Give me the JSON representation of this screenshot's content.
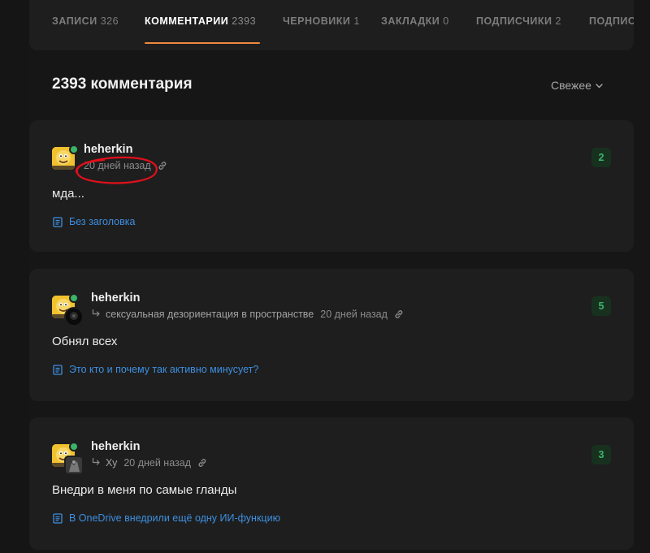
{
  "tabs": [
    {
      "label": "ЗАПИСИ",
      "count": "326"
    },
    {
      "label": "КОММЕНТАРИИ",
      "count": "2393"
    },
    {
      "label": "ЧЕРНОВИКИ",
      "count": "1"
    },
    {
      "label": "ЗАКЛАДКИ",
      "count": "0"
    },
    {
      "label": "ПОДПИСЧИКИ",
      "count": "2"
    },
    {
      "label": "ПОДПИС",
      "count": ""
    }
  ],
  "active_tab_index": 1,
  "heading": "2393 комментария",
  "sort": {
    "label": "Свежее"
  },
  "comments": [
    {
      "author": "heherkin",
      "reply_to": "",
      "time": "20 дней назад",
      "text": "мда...",
      "post_title": "Без заголовка",
      "rating": "2"
    },
    {
      "author": "heherkin",
      "reply_to": "сексуальная дезориентация в пространстве",
      "time": "20 дней назад",
      "text": "Обнял всех",
      "post_title": "Это кто и почему так активно минусует?",
      "rating": "5"
    },
    {
      "author": "heherkin",
      "reply_to": "Ху",
      "time": "20 дней назад",
      "text": "Внедри в меня по самые гланды",
      "post_title": "В OneDrive внедрили ещё одну ИИ-функцию",
      "rating": "3"
    }
  ],
  "colors": {
    "accent": "#f0883e",
    "link": "#3d8fe0",
    "rating_bg": "#18311f",
    "rating_fg": "#3bb36a",
    "annotation": "#e0101a"
  },
  "icons": {
    "sort": "chevron-down-icon",
    "reply": "reply-arrow-icon",
    "link": "link-icon",
    "post": "document-icon"
  }
}
